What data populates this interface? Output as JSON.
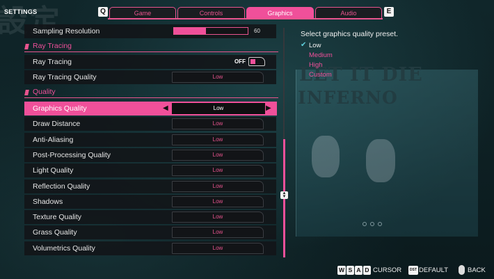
{
  "header": {
    "title": "SETTINGS",
    "kanji": "設定",
    "prev_key": "Q",
    "next_key": "E",
    "tabs": [
      {
        "label": "Game"
      },
      {
        "label": "Controls"
      },
      {
        "label": "Graphics",
        "active": true
      },
      {
        "label": "Audio"
      }
    ]
  },
  "settings": {
    "sampling": {
      "label": "Sampling Resolution",
      "value": "60",
      "fraction": 0.6
    },
    "ray_section": "Ray Tracing",
    "ray_tracing": {
      "label": "Ray Tracing",
      "state": "OFF"
    },
    "ray_tracing_quality": {
      "label": "Ray Tracing Quality",
      "value": "Low"
    },
    "quality_section": "Quality",
    "rows": [
      {
        "label": "Graphics Quality",
        "value": "Low",
        "selected": true
      },
      {
        "label": "Draw Distance",
        "value": "Low"
      },
      {
        "label": "Anti-Aliasing",
        "value": "Low"
      },
      {
        "label": "Post-Processing Quality",
        "value": "Low"
      },
      {
        "label": "Light Quality",
        "value": "Low"
      },
      {
        "label": "Reflection Quality",
        "value": "Low"
      },
      {
        "label": "Shadows",
        "value": "Low"
      },
      {
        "label": "Texture Quality",
        "value": "Low"
      },
      {
        "label": "Grass Quality",
        "value": "Low"
      },
      {
        "label": "Volumetrics Quality",
        "value": "Low"
      }
    ],
    "arrow_left": "◀",
    "arrow_right": "▶"
  },
  "description": {
    "text": "Select graphics quality preset.",
    "check": "✔",
    "options": [
      "Low",
      "Medium",
      "High",
      "Custom"
    ],
    "selected": "Low"
  },
  "preview": {
    "logo_line1": "LET IT DIE",
    "logo_line2": "INFERNO"
  },
  "footer": {
    "keys": [
      "W",
      "S",
      "A",
      "D"
    ],
    "cursor_label": "CURSOR",
    "default_key": "DST",
    "default_label": "DEFAULT",
    "back_label": "BACK"
  },
  "colors": {
    "accent": "#f0509a",
    "background": "#0d1a1c",
    "check": "#5fd0dc"
  }
}
